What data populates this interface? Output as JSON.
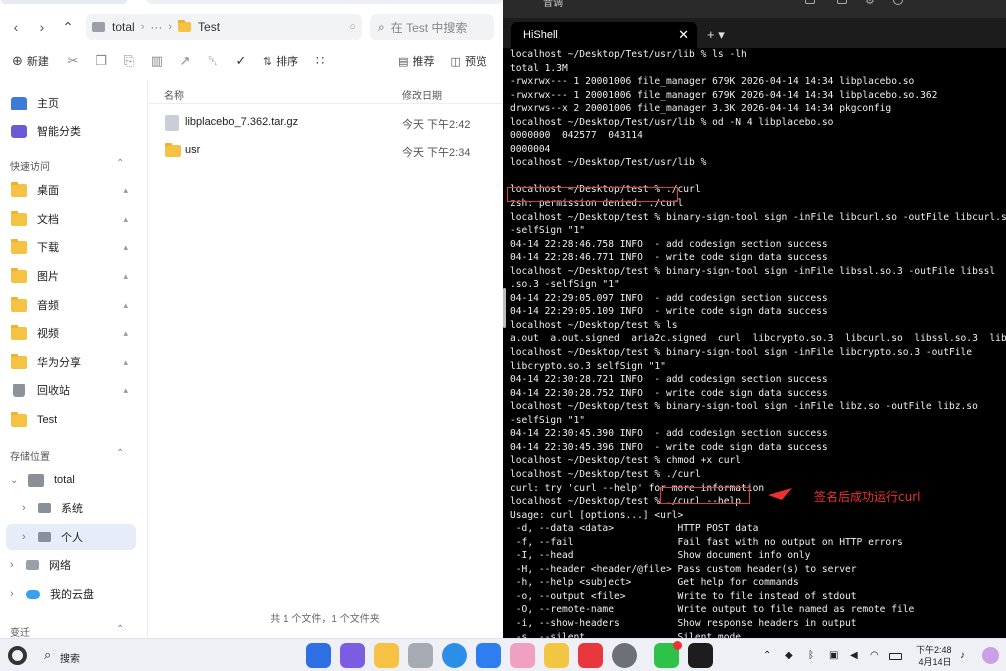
{
  "file_manager": {
    "tab_title": "Test",
    "path": [
      "total",
      "···",
      "Test"
    ],
    "search_placeholder": "在 Test 中搜索",
    "toolbar": {
      "new": "新建",
      "sort": "排序",
      "recommend": "推荐",
      "preview": "预览"
    },
    "sidebar": {
      "top_items": [
        "主页",
        "智能分类"
      ],
      "quick_access_label": "快速访问",
      "quick_items": [
        "桌面",
        "文档",
        "下载",
        "图片",
        "音频",
        "视频",
        "华为分享",
        "回收站",
        "Test"
      ],
      "storage_label": "存储位置",
      "storage_items": [
        "total",
        "系统",
        "个人",
        "网络",
        "我的云盘"
      ],
      "bottom_label": "变迁"
    },
    "columns": {
      "name": "名称",
      "modified": "修改日期"
    },
    "files": [
      {
        "name": "libplacebo_7.362.tar.gz",
        "date": "今天 下午2:42",
        "kind": "archive"
      },
      {
        "name": "usr",
        "date": "今天 下午2:34",
        "kind": "folder"
      }
    ],
    "status": "共 1 个文件，1 个文件夹"
  },
  "terminal": {
    "app_title": "音调",
    "tab_title": "HiShell",
    "lines": [
      "localhost ~/Desktop/Test/usr/lib % ls -lh",
      "total 1.3M",
      "-rwxrwx--- 1 20001006 file_manager 679K 2026-04-14 14:34 libplacebo.so",
      "-rwxrwx--- 1 20001006 file_manager 679K 2026-04-14 14:34 libplacebo.so.362",
      "drwxrws--x 2 20001006 file_manager 3.3K 2026-04-14 14:34 pkgconfig",
      "localhost ~/Desktop/Test/usr/lib % od -N 4 libplacebo.so",
      "0000000  042577  043114",
      "0000004",
      "localhost ~/Desktop/Test/usr/lib %",
      "",
      "localhost ~/Desktop/test % ./curl",
      "zsh: permission denied: ./curl",
      "localhost ~/Desktop/test % binary-sign-tool sign -inFile libcurl.so -outFile libcurl.so",
      "-selfSign \"1\"",
      "04-14 22:28:46.758 INFO  - add codesign section success",
      "04-14 22:28:46.771 INFO  - write code sign data success",
      "localhost ~/Desktop/test % binary-sign-tool sign -inFile libssl.so.3 -outFile libssl",
      ".so.3 -selfSign \"1\"",
      "04-14 22:29:05.097 INFO  - add codesign section success",
      "04-14 22:29:05.109 INFO  - write code sign data success",
      "localhost ~/Desktop/test % ls",
      "a.out  a.out.signed  aria2c.signed  curl  libcrypto.so.3  libcurl.so  libssl.so.3  libz.so",
      "localhost ~/Desktop/test % binary-sign-tool sign -inFile libcrypto.so.3 -outFile",
      "libcrypto.so.3 selfSign \"1\"",
      "04-14 22:30:28.721 INFO  - add codesign section success",
      "04-14 22:30:28.752 INFO  - write code sign data success",
      "localhost ~/Desktop/test % binary-sign-tool sign -inFile libz.so -outFile libz.so",
      "-selfSign \"1\"",
      "04-14 22:30:45.390 INFO  - add codesign section success",
      "04-14 22:30:45.396 INFO  - write code sign data success",
      "localhost ~/Desktop/test % chmod +x curl",
      "localhost ~/Desktop/test % ./curl",
      "curl: try 'curl --help' for more information",
      "localhost ~/Desktop/test % ./curl --help",
      "Usage: curl [options...] <url>",
      " -d, --data <data>           HTTP POST data",
      " -f, --fail                  Fail fast with no output on HTTP errors",
      " -I, --head                  Show document info only",
      " -H, --header <header/@file> Pass custom header(s) to server",
      " -h, --help <subject>        Get help for commands",
      " -o, --output <file>         Write to file instead of stdout",
      " -O, --remote-name           Write output to file named as remote file",
      " -i, --show-headers          Show response headers in output",
      " -s, --silent                Silent mode"
    ],
    "annotation": "签名后成功运行curl"
  },
  "taskbar": {
    "search": "搜索",
    "time": "下午2:48",
    "date": "4月14日"
  },
  "colors": {
    "highlight": "#e23a3a",
    "folder": "#f6c244",
    "selection": "#e6edf8"
  }
}
